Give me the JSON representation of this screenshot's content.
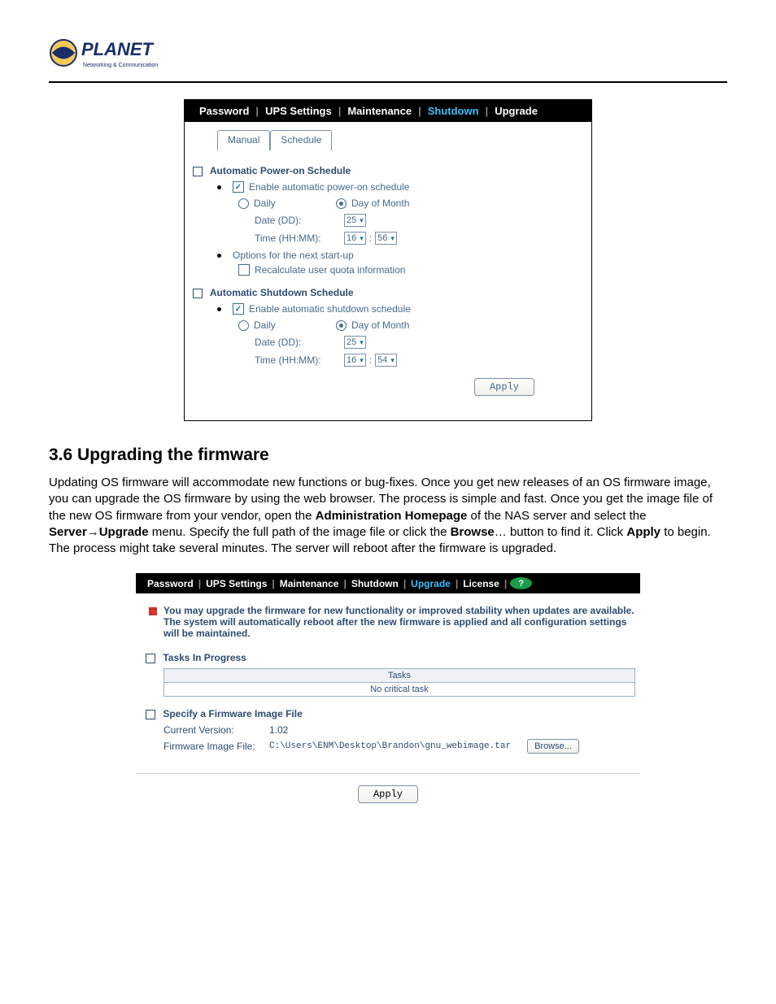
{
  "logo": {
    "brand": "PLANET",
    "tagline": "Networking & Communication"
  },
  "screenshot1": {
    "tabs": [
      "Password",
      "UPS Settings",
      "Maintenance",
      "Shutdown",
      "Upgrade"
    ],
    "active_tab": "Shutdown",
    "sub_tabs": [
      "Manual",
      "Schedule"
    ],
    "active_sub_tab": "Schedule",
    "poweron": {
      "heading": "Automatic Power-on Schedule",
      "enable_label": "Enable automatic power-on schedule",
      "enable_checked": true,
      "daily_label": "Daily",
      "dom_label": "Day of Month",
      "dom_selected": true,
      "date_label": "Date (DD):",
      "date_value": "25",
      "time_label": "Time (HH:MM):",
      "time_hh": "16",
      "time_mm": "56",
      "options_label": "Options for the next start-up",
      "recalc_label": "Recalculate user quota information",
      "recalc_checked": false
    },
    "shutdown": {
      "heading": "Automatic Shutdown Schedule",
      "enable_label": "Enable automatic shutdown schedule",
      "enable_checked": true,
      "daily_label": "Daily",
      "dom_label": "Day of Month",
      "dom_selected": true,
      "date_label": "Date (DD):",
      "date_value": "25",
      "time_label": "Time (HH:MM):",
      "time_hh": "16",
      "time_mm": "54"
    },
    "apply_label": "Apply"
  },
  "heading": "3.6 Upgrading the firmware",
  "body_html": "Updating OS firmware will accommodate new functions or bug-fixes. Once you get new releases of an OS firmware image, you can upgrade the OS firmware by using the web browser. The process is simple and fast. Once you get the image file of the new OS firmware from your vendor, open the <b>Administration Homepage</b> of the NAS server and select the <b>Server→Upgrade</b> menu. Specify the full path of the image file or click the <b>Browse</b>… button to find it. Click <b>Apply</b> to begin. The process might take several minutes. The server will reboot after the firmware is upgraded.",
  "screenshot2": {
    "tabs": [
      "Password",
      "UPS Settings",
      "Maintenance",
      "Shutdown",
      "Upgrade",
      "License"
    ],
    "active_tab": "Upgrade",
    "notice": "You may upgrade the firmware for new functionality or improved stability when updates are available. The system will automatically reboot after the new firmware is applied and all configuration settings will be maintained.",
    "tasks_heading": "Tasks In Progress",
    "tasks_col": "Tasks",
    "tasks_row": "No critical task",
    "spec_heading": "Specify a Firmware Image File",
    "cur_version_label": "Current Version:",
    "cur_version_value": "1.02",
    "fw_file_label": "Firmware Image File:",
    "fw_file_value": "C:\\Users\\ENM\\Desktop\\Brandon\\gnu_webimage.tar",
    "browse_label": "Browse...",
    "apply_label": "Apply"
  }
}
